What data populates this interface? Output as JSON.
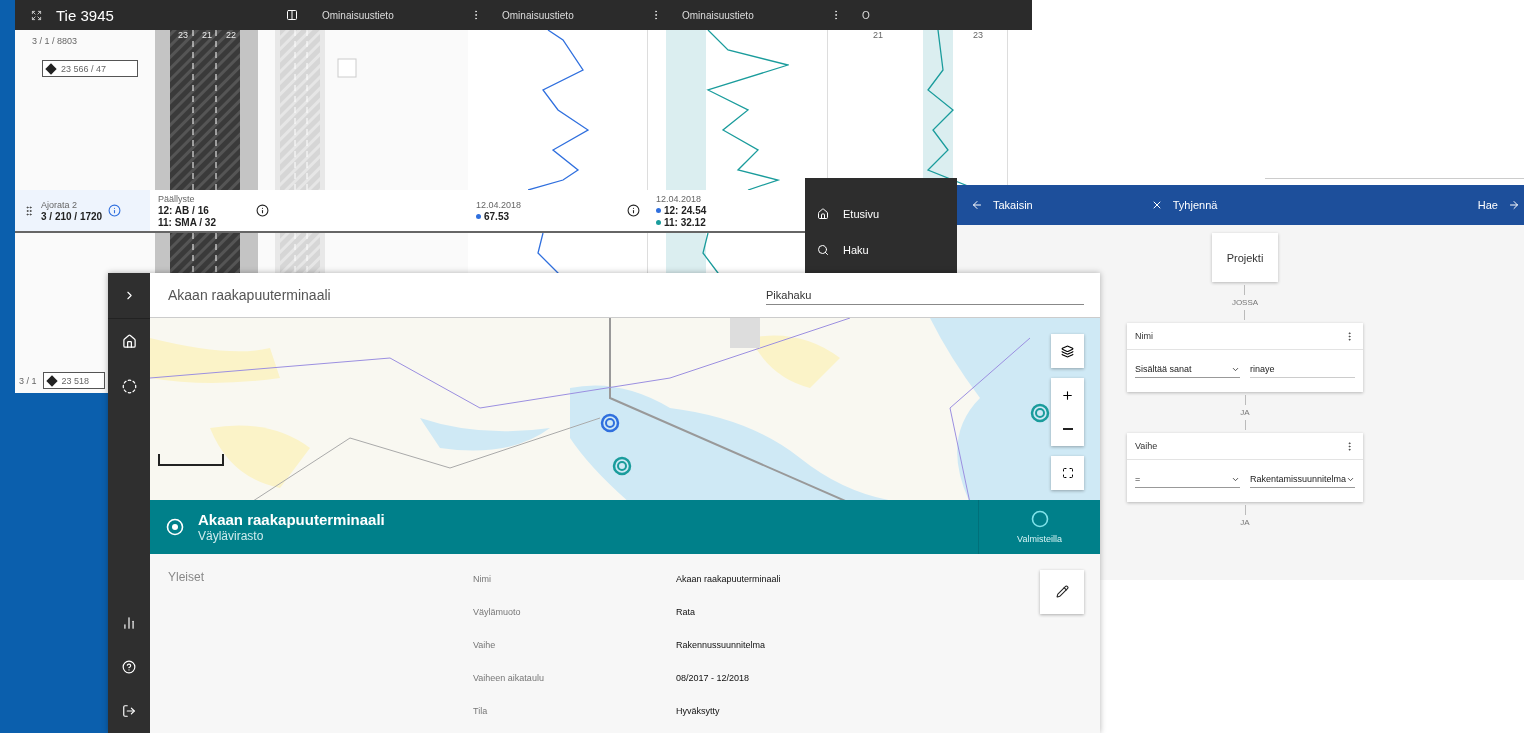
{
  "road_window": {
    "title": "Tie 3945",
    "columns": [
      {
        "label": "Ominaisuustieto"
      },
      {
        "label": "Ominaisuustieto"
      },
      {
        "label": "Ominaisuustieto"
      },
      {
        "label": "O"
      }
    ],
    "address_top": "3 / 1 / 8803",
    "marker_label": "23 566 / 47",
    "lane_numbers": [
      "23",
      "21",
      "22"
    ],
    "chart_lane_numbers": [
      "21",
      "23"
    ],
    "info": {
      "carriageway_label": "Ajorata 2",
      "carriageway_value": "3 / 210 / 1720",
      "pavement_label": "Päällyste",
      "pavement_lines": [
        "12: AB / 16",
        "11: SMA / 32"
      ],
      "readings": [
        {
          "date": "12.04.2018",
          "values": [
            {
              "text": "67.53",
              "color": "#2f6fde"
            }
          ]
        },
        {
          "date": "12.04.2018",
          "values": [
            {
              "text": "12: 24.54",
              "color": "#2f6fde"
            },
            {
              "text": "11: 32.12",
              "color": "#1a9c9c"
            }
          ]
        }
      ]
    },
    "address_bottom": "3 / 1",
    "marker_label_bottom": "23 518"
  },
  "menu": {
    "items": [
      {
        "label": "Etusivu"
      },
      {
        "label": "Haku"
      }
    ]
  },
  "search_window": {
    "back": "Takaisin",
    "clear": "Tyhjennä",
    "submit": "Hae",
    "root": "Projekti",
    "connectors": [
      "JOSSA",
      "JA",
      "JA"
    ],
    "conditions": [
      {
        "field": "Nimi",
        "operator": "Sisältää sanat",
        "value": "rinaye"
      },
      {
        "field": "Vaihe",
        "operator": "=",
        "value": "Rakentamissuunnitelma"
      }
    ]
  },
  "main_window": {
    "title": "Akaan raakapuuterminaali",
    "search": {
      "placeholder": "Pikahaku"
    },
    "banner": {
      "title": "Akaan raakapuuterminaali",
      "subtitle": "Väylävirasto",
      "action": "Valmisteilla"
    },
    "section": "Yleiset",
    "fields": [
      {
        "label": "Nimi",
        "value": "Akaan raakapuuterminaali"
      },
      {
        "label": "Väylämuoto",
        "value": "Rata"
      },
      {
        "label": "Vaihe",
        "value": "Rakennussuunnitelma"
      },
      {
        "label": "Vaiheen aikataulu",
        "value": "08/2017 - 12/2018"
      },
      {
        "label": "Tila",
        "value": "Hyväksytty"
      }
    ]
  }
}
